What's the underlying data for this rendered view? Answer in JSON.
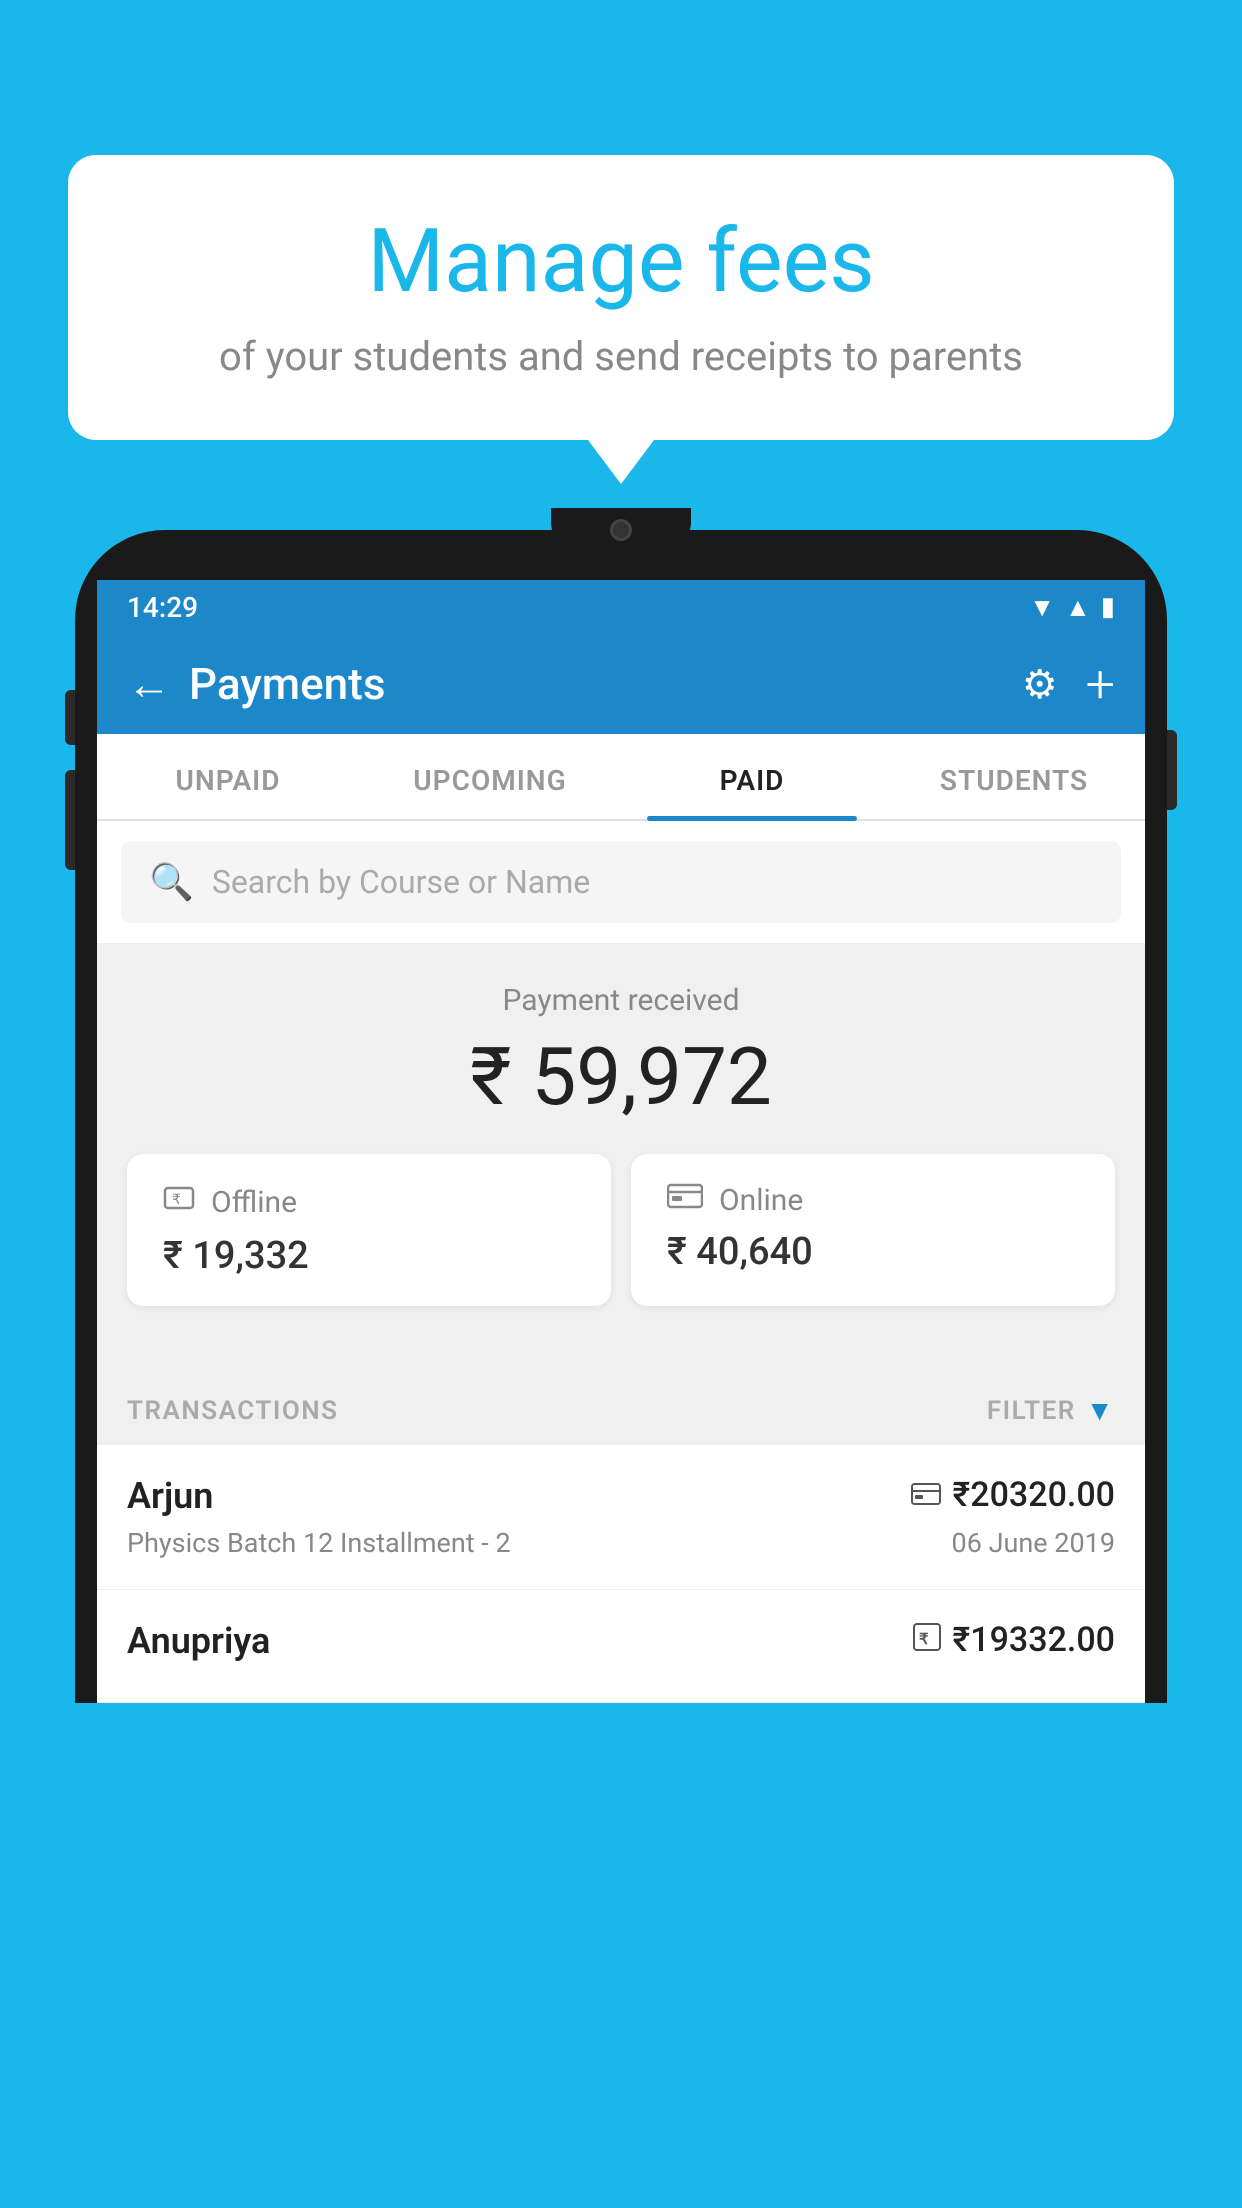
{
  "page": {
    "background_color": "#1ab7ea"
  },
  "speech_bubble": {
    "title": "Manage fees",
    "subtitle": "of your students and send receipts to parents"
  },
  "status_bar": {
    "time": "14:29",
    "icons": [
      "wifi",
      "signal",
      "battery"
    ]
  },
  "app_header": {
    "title": "Payments",
    "back_label": "←",
    "settings_label": "⚙",
    "add_label": "+"
  },
  "tabs": [
    {
      "label": "UNPAID",
      "active": false
    },
    {
      "label": "UPCOMING",
      "active": false
    },
    {
      "label": "PAID",
      "active": true
    },
    {
      "label": "STUDENTS",
      "active": false
    }
  ],
  "search": {
    "placeholder": "Search by Course or Name"
  },
  "payment_summary": {
    "label": "Payment received",
    "amount": "₹ 59,972",
    "offline": {
      "label": "Offline",
      "amount": "₹ 19,332"
    },
    "online": {
      "label": "Online",
      "amount": "₹ 40,640"
    }
  },
  "transactions": {
    "header_label": "TRANSACTIONS",
    "filter_label": "FILTER",
    "items": [
      {
        "name": "Arjun",
        "amount": "₹20320.00",
        "detail": "Physics Batch 12 Installment - 2",
        "date": "06 June 2019",
        "method": "card"
      },
      {
        "name": "Anupriya",
        "amount": "₹19332.00",
        "detail": "",
        "date": "",
        "method": "rupee"
      }
    ]
  }
}
